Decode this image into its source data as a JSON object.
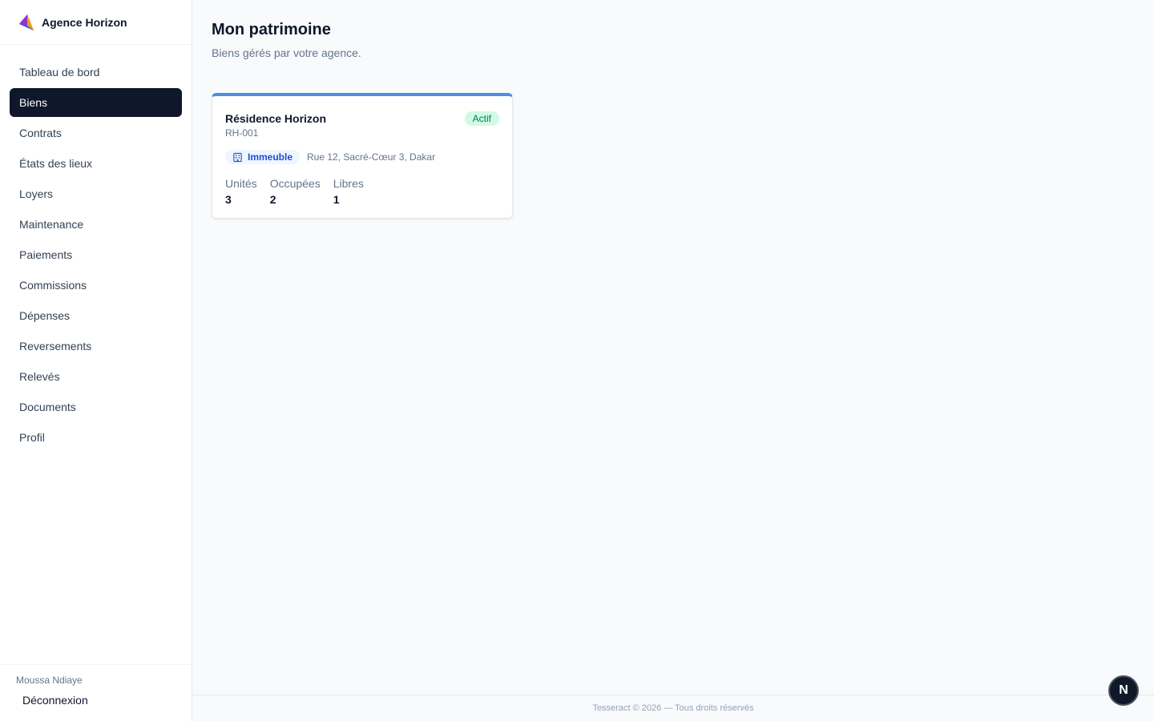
{
  "brand": {
    "name": "Agence Horizon"
  },
  "sidebar": {
    "items": [
      {
        "label": "Tableau de bord"
      },
      {
        "label": "Biens",
        "active": true
      },
      {
        "label": "Contrats"
      },
      {
        "label": "États des lieux"
      },
      {
        "label": "Loyers"
      },
      {
        "label": "Maintenance"
      },
      {
        "label": "Paiements"
      },
      {
        "label": "Commissions"
      },
      {
        "label": "Dépenses"
      },
      {
        "label": "Reversements"
      },
      {
        "label": "Relevés"
      },
      {
        "label": "Documents"
      },
      {
        "label": "Profil"
      }
    ],
    "user_name": "Moussa Ndiaye",
    "logout_label": "Déconnexion"
  },
  "page": {
    "title": "Mon patrimoine",
    "subtitle": "Biens gérés par votre agence."
  },
  "property": {
    "name": "Résidence Horizon",
    "ref": "RH-001",
    "status": "Actif",
    "type": "Immeuble",
    "address": "Rue 12, Sacré-Cœur 3, Dakar",
    "stats": [
      {
        "label": "Unités",
        "value": "3"
      },
      {
        "label": "Occupées",
        "value": "2"
      },
      {
        "label": "Libres",
        "value": "1"
      }
    ]
  },
  "footer": {
    "text": "Tesseract © 2026 — Tous droits réservés"
  },
  "fab": {
    "label": "N"
  },
  "colors": {
    "accent": "#4a90e2",
    "active_nav": "#0f172a",
    "status_bg": "#d1fae5",
    "status_text": "#047857"
  }
}
